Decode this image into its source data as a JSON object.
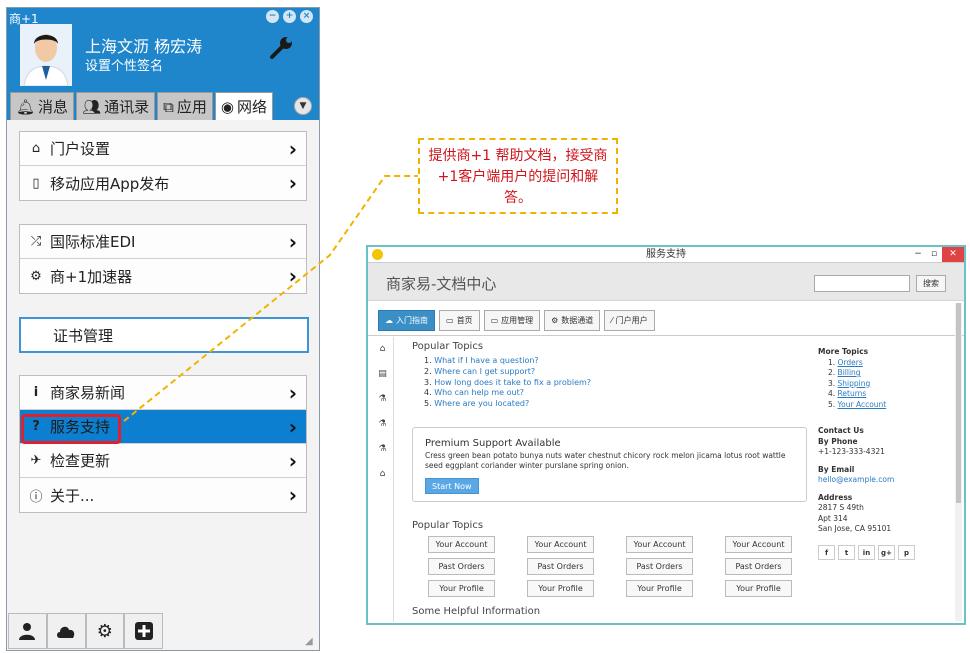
{
  "client": {
    "app_title": "商+1",
    "user_name": "上海文沥 杨宏涛",
    "user_signature": "设置个性签名",
    "tabs": [
      {
        "label": "消息",
        "icon": "bell-icon"
      },
      {
        "label": "通讯录",
        "icon": "users-icon"
      },
      {
        "label": "应用",
        "icon": "puzzle-icon"
      },
      {
        "label": "网络",
        "icon": "globe-icon"
      }
    ],
    "group1": [
      {
        "label": "门户设置",
        "icon": "home-icon"
      },
      {
        "label": "移动应用App发布",
        "icon": "mobile-icon"
      }
    ],
    "group2": [
      {
        "label": "国际标准EDI",
        "icon": "shuffle-icon"
      },
      {
        "label": "商+1加速器",
        "icon": "gears-icon"
      }
    ],
    "cert_label": "证书管理",
    "group3": [
      {
        "label": "商家易新闻",
        "icon": "info-icon"
      },
      {
        "label": "服务支持",
        "icon": "question-icon"
      },
      {
        "label": "检查更新",
        "icon": "plane-icon"
      },
      {
        "label": "关于...",
        "icon": "info-circle-icon"
      }
    ],
    "selected_item": "服务支持",
    "bottom_icons": [
      "user-icon",
      "cloud-icon",
      "gear-icon",
      "plus-icon"
    ]
  },
  "callout": {
    "text": "提供商+1 帮助文档，接受商+1客户端用户的提问和解答。",
    "border_color": "#f0b400",
    "text_color": "#d0141c"
  },
  "support_window": {
    "title": "服务支持",
    "brand": "商家易-文档中心",
    "search_button": "搜索",
    "nav": [
      "入门指南",
      "首页",
      "应用管理",
      "数据通道",
      "门户用户"
    ],
    "popular_topics_title": "Popular Topics",
    "topics": [
      "What if I have a question?",
      "Where can I get support?",
      "How long does it take to fix a problem?",
      "Who can help me out?",
      "Where are you located?"
    ],
    "premium_title": "Premium Support Available",
    "premium_text": "Cress green bean potato bunya nuts water chestnut chicory rock melon jicama lotus root wattle seed eggplant coriander winter purslane spring onion.",
    "start_button": "Start Now",
    "grid_title": "Popular Topics",
    "grid": [
      "Your Account",
      "Your Account",
      "Your Account",
      "Your Account",
      "Past Orders",
      "Past Orders",
      "Past Orders",
      "Past Orders",
      "Your Profile",
      "Your Profile",
      "Your Profile",
      "Your Profile"
    ],
    "helpful_title": "Some Helpful Information",
    "more_topics_title": "More Topics",
    "more_topics": [
      "Orders",
      "Billing",
      "Shipping",
      "Returns",
      "Your Account"
    ],
    "contact_title": "Contact Us",
    "by_phone_label": "By Phone",
    "phone": "+1-123-333-4321",
    "by_email_label": "By Email",
    "email": "hello@example.com",
    "address_label": "Address",
    "address_lines": [
      "2817 S 49th",
      "Apt 314",
      "San Jose, CA 95101"
    ],
    "social": [
      "f",
      "t",
      "in",
      "g+",
      "p"
    ]
  }
}
